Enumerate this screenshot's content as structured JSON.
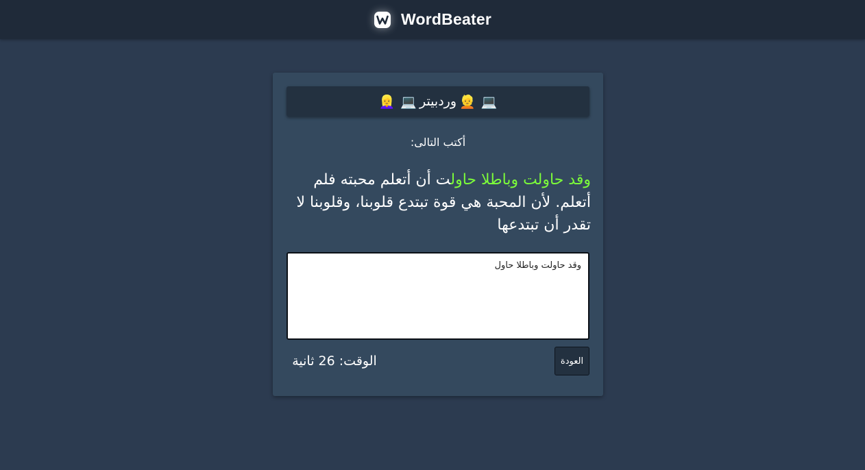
{
  "nav": {
    "brand_name": "WordBeater",
    "logo_icon": "w-logo-icon"
  },
  "card": {
    "header_title": "وردبيتر",
    "header_emojis": {
      "laptop_1": "💻",
      "person_1": "👱",
      "laptop_2": "💻",
      "person_2": "👱‍♀️"
    },
    "prompt_label": "أكتب التالى:",
    "target_typed": "وقد حاولت وباطلا حاول",
    "target_remaining": "ت أن أتعلم محبته فلم أتعلم. لأن المحبة هي قوة تبتدع قلوبنا، وقلوبنا لا تقدر أن تبتدعها",
    "input_value": "وقد حاولت وباطلا حاول",
    "back_button_label": "العودة",
    "timer_text": "الوقت: 26 ثانية"
  },
  "colors": {
    "page_bg": "#2c3b50",
    "navbar_bg": "#1f2a39",
    "card_bg": "#34495e",
    "header_bg": "#233140",
    "typed_color": "#7cfc3a"
  }
}
